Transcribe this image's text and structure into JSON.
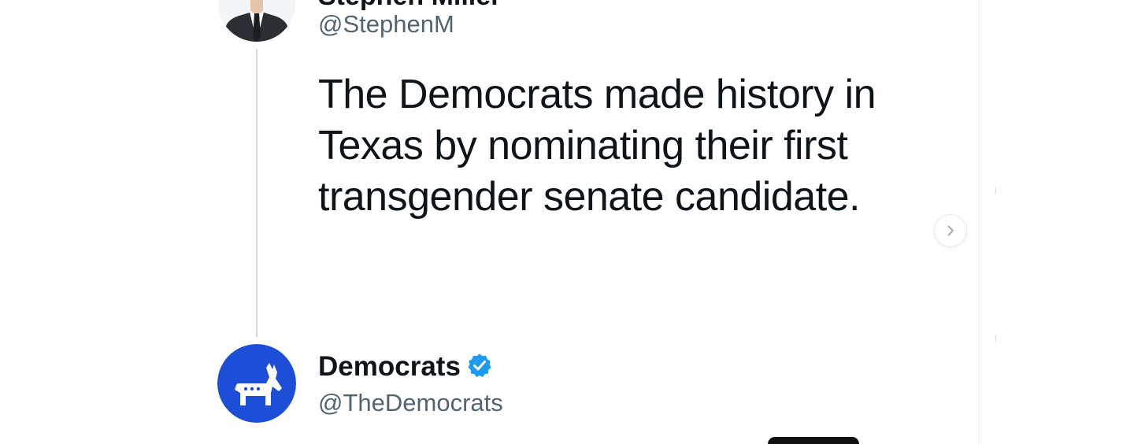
{
  "tweet_top": {
    "author_name_partial": "Stephen Miller",
    "author_handle": "@StephenM",
    "avatar_icon": "portrait-icon",
    "text": "The Democrats made history in Texas by nominating their first transgender senate candidate."
  },
  "tweet_reply": {
    "author_name": "Democrats",
    "author_handle": "@TheDemocrats",
    "verified_icon": "verified-badge-icon",
    "avatar_icon": "donkey-logo-icon"
  },
  "navigation": {
    "next_icon": "chevron-right-icon"
  },
  "colors": {
    "democrats_blue": "#1c4ed8",
    "verified_blue": "#1d9bf0",
    "handle_gray": "#536471",
    "text_dark": "#0f1419"
  }
}
